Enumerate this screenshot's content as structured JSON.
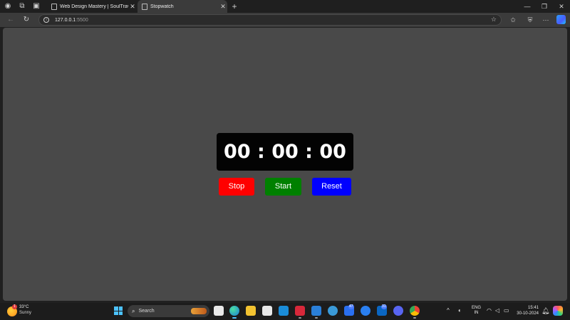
{
  "browser": {
    "tabs": [
      {
        "title": "Web Design Mastery | SoulTravel",
        "active": false
      },
      {
        "title": "Stopwatch",
        "active": true
      }
    ],
    "address": {
      "host": "127.0.0.1",
      "port": ":5500"
    }
  },
  "stopwatch": {
    "display": "00 : 00 : 00",
    "buttons": {
      "stop": "Stop",
      "start": "Start",
      "reset": "Reset"
    },
    "colors": {
      "page_bg": "#494949",
      "display_bg": "#030303",
      "stop": "#ff0000",
      "start": "#008000",
      "reset": "#0000ff"
    }
  },
  "taskbar": {
    "weather": {
      "temp": "33°C",
      "condition": "Sunny",
      "badge": "1"
    },
    "search_label": "Search",
    "badges": {
      "app_a": "47",
      "app_b": "31"
    },
    "lang": {
      "line1": "ENG",
      "line2": "IN"
    },
    "clock": {
      "time": "15:41",
      "date": "30-10-2024"
    }
  }
}
